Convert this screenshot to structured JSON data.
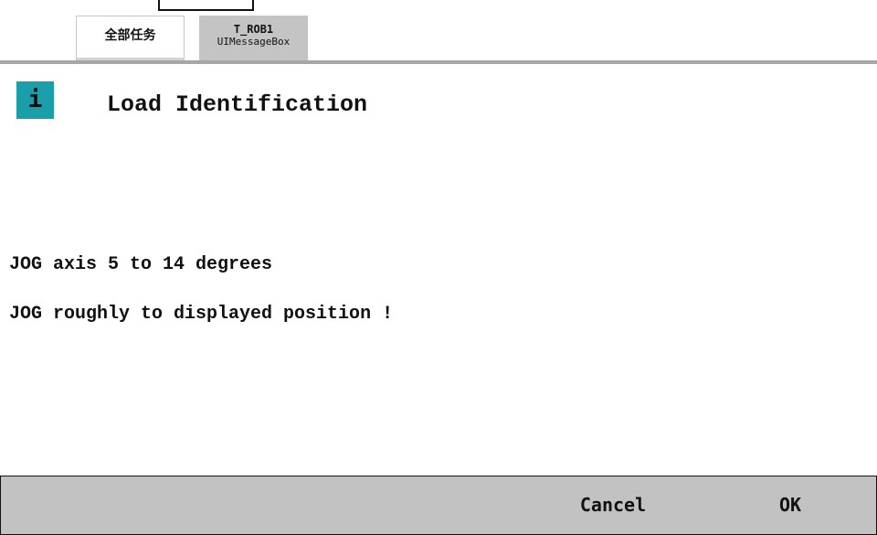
{
  "tabs": [
    {
      "label": "全部任务"
    },
    {
      "label": "T_ROB1",
      "sublabel": "UIMessageBox"
    }
  ],
  "dialog": {
    "icon": "info-icon",
    "icon_glyph": "i",
    "icon_color": "#1a9faa",
    "title": "Load Identification",
    "messages": [
      "JOG axis 5 to 14 degrees",
      "JOG roughly to displayed position !"
    ]
  },
  "footer": {
    "cancel_label": "Cancel",
    "ok_label": "OK"
  }
}
